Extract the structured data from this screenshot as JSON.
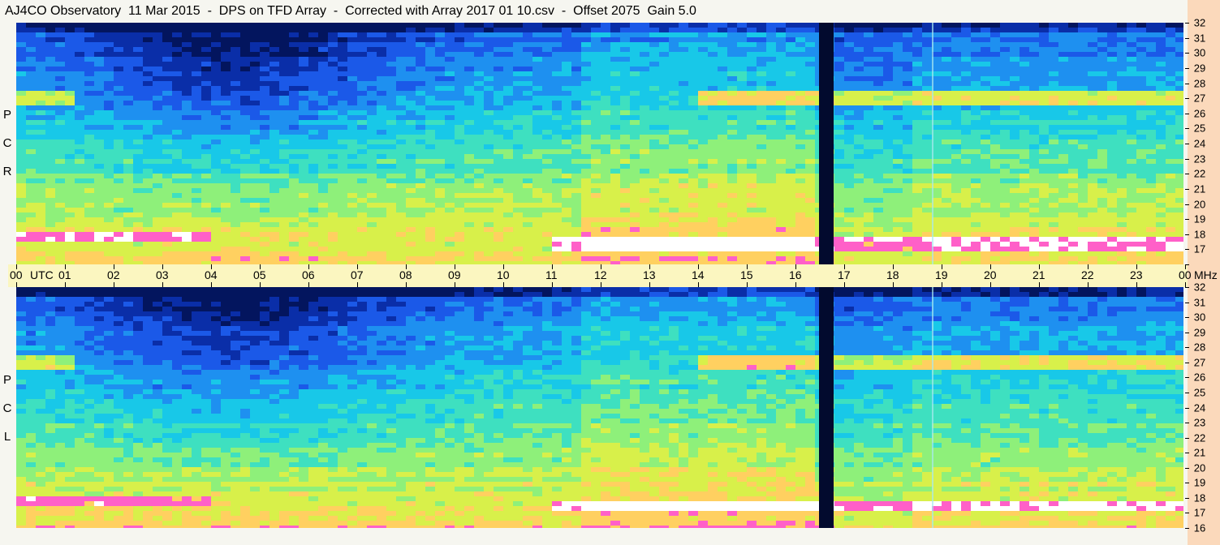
{
  "title": "AJ4CO Observatory  11 Mar 2015  -  DPS on TFD Array  -  Corrected with Array 2017 01 10.csv  -  Offset 2075  Gain 5.0",
  "top_pol_letters": [
    "P",
    "C",
    "R"
  ],
  "bottom_pol_letters": [
    "P",
    "C",
    "L"
  ],
  "time_axis": {
    "labels": [
      "00",
      "UTC",
      "01",
      "02",
      "03",
      "04",
      "05",
      "06",
      "07",
      "08",
      "09",
      "10",
      "11",
      "12",
      "13",
      "14",
      "15",
      "16",
      "17",
      "18",
      "19",
      "20",
      "21",
      "22",
      "23",
      "00",
      "MHz"
    ]
  },
  "freq_axis_labels": [
    "32",
    "31",
    "30",
    "29",
    "28",
    "27",
    "26",
    "25",
    "24",
    "23",
    "22",
    "21",
    "20",
    "19",
    "18",
    "17",
    "16"
  ],
  "chart_data": [
    {
      "type": "heatmap",
      "panel": "RCP",
      "xlabel": "UTC",
      "ylabel": "MHz",
      "x_range_hours": [
        0,
        24
      ],
      "y_range_mhz": [
        16,
        32
      ],
      "x_ticks": [
        "00",
        "01",
        "02",
        "03",
        "04",
        "05",
        "06",
        "07",
        "08",
        "09",
        "10",
        "11",
        "12",
        "13",
        "14",
        "15",
        "16",
        "17",
        "18",
        "19",
        "20",
        "21",
        "22",
        "23",
        "00"
      ],
      "y_ticks": [
        32,
        31,
        30,
        29,
        28,
        27,
        26,
        25,
        24,
        23,
        22,
        21,
        20,
        19,
        18,
        17,
        16
      ],
      "colorscale": [
        "#03155e",
        "#0a2ea8",
        "#1b59e8",
        "#1e90f0",
        "#18c8e8",
        "#3ee0c0",
        "#8ef07a",
        "#d8f04a",
        "#ffd060",
        "#ff60c8",
        "#ffffff"
      ]
    },
    {
      "type": "heatmap",
      "panel": "LCP",
      "xlabel": "UTC",
      "ylabel": "MHz",
      "x_range_hours": [
        0,
        24
      ],
      "y_range_mhz": [
        16,
        32
      ],
      "x_ticks": [
        "00",
        "01",
        "02",
        "03",
        "04",
        "05",
        "06",
        "07",
        "08",
        "09",
        "10",
        "11",
        "12",
        "13",
        "14",
        "15",
        "16",
        "17",
        "18",
        "19",
        "20",
        "21",
        "22",
        "23",
        "00"
      ],
      "y_ticks": [
        32,
        31,
        30,
        29,
        28,
        27,
        26,
        25,
        24,
        23,
        22,
        21,
        20,
        19,
        18,
        17,
        16
      ],
      "colorscale": [
        "#03155e",
        "#0a2ea8",
        "#1b59e8",
        "#1e90f0",
        "#18c8e8",
        "#3ee0c0",
        "#8ef07a",
        "#d8f04a",
        "#ffd060",
        "#ff60c8",
        "#ffffff"
      ]
    }
  ]
}
